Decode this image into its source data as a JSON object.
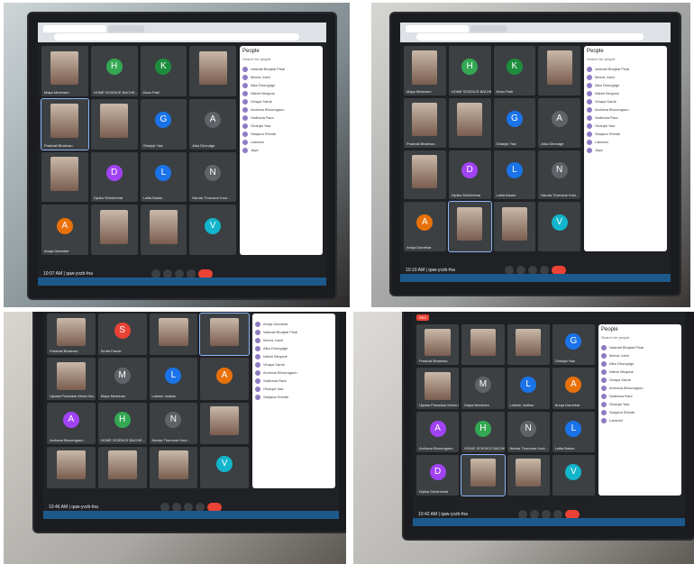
{
  "panels": [
    {
      "people_title": "People",
      "search": "Search for people",
      "clock": "10:07 AM",
      "meeting_code": "qaw-yvzb-fna",
      "tiles": [
        {
          "name": "Maya Meshram",
          "initial": "",
          "color": "",
          "cam": true
        },
        {
          "name": "HOME SCIENCE BACHE...",
          "initial": "H",
          "color": "#34a853",
          "cam": false
        },
        {
          "name": "Khan Patil",
          "initial": "K",
          "color": "#1e8e3e",
          "cam": false
        },
        {
          "name": "",
          "initial": "",
          "color": "",
          "cam": true
        },
        {
          "name": "Prashali Bhalerao",
          "initial": "",
          "color": "",
          "cam": true,
          "active": true
        },
        {
          "name": "",
          "initial": "",
          "color": "",
          "cam": true
        },
        {
          "name": "Ghanjal Yaw",
          "initial": "G",
          "color": "#1a73e8",
          "cam": false
        },
        {
          "name": "Alka Dhondge",
          "initial": "A",
          "color": "#5f6368",
          "cam": false
        },
        {
          "name": "",
          "initial": "",
          "color": "",
          "cam": true
        },
        {
          "name": "Dipika Shrishrimal",
          "initial": "D",
          "color": "#a142f4",
          "cam": false
        },
        {
          "name": "Lalita Baske",
          "initial": "L",
          "color": "#1a73e8",
          "cam": false
        },
        {
          "name": "Nanda Thorvane Koul...",
          "initial": "N",
          "color": "#5f6368",
          "cam": false
        },
        {
          "name": "Anuja Darvekar",
          "initial": "A",
          "color": "#e8710a",
          "cam": false
        },
        {
          "name": "",
          "initial": "",
          "color": "",
          "cam": true
        },
        {
          "name": "",
          "initial": "",
          "color": "",
          "cam": true
        },
        {
          "name": "",
          "initial": "V",
          "color": "#12b5cb",
          "cam": false
        }
      ],
      "people": [
        "Vaishali Bhujbal Pisal",
        "Meera Joshi",
        "Alka Dhongdge",
        "Nilesh Bhojane",
        "Vinaya Sarde",
        "Archana Bhoomgaon",
        "Sadhana Raut",
        "Ghanjal Yaw",
        "Sanjana Shinde",
        "Lakshmi",
        "Jaya"
      ]
    },
    {
      "people_title": "People",
      "search": "Search for people",
      "clock": "10:10 AM",
      "meeting_code": "qaw-yvzb-fna",
      "tiles": [
        {
          "name": "Maya Meshram",
          "initial": "",
          "color": "",
          "cam": true
        },
        {
          "name": "HOME SCIENCE BACHE...",
          "initial": "H",
          "color": "#34a853",
          "cam": false
        },
        {
          "name": "Khan Patil",
          "initial": "K",
          "color": "#1e8e3e",
          "cam": false
        },
        {
          "name": "",
          "initial": "",
          "color": "",
          "cam": true
        },
        {
          "name": "Prashali Bhalerao",
          "initial": "",
          "color": "",
          "cam": true
        },
        {
          "name": "",
          "initial": "",
          "color": "",
          "cam": true
        },
        {
          "name": "Ghanjal Yaw",
          "initial": "G",
          "color": "#1a73e8",
          "cam": false
        },
        {
          "name": "Alka Dhondge",
          "initial": "A",
          "color": "#5f6368",
          "cam": false
        },
        {
          "name": "",
          "initial": "",
          "color": "",
          "cam": true
        },
        {
          "name": "Dipika Shrishrimal",
          "initial": "D",
          "color": "#a142f4",
          "cam": false
        },
        {
          "name": "Lalita Baske",
          "initial": "L",
          "color": "#1a73e8",
          "cam": false
        },
        {
          "name": "Nanda Thorvane Koul...",
          "initial": "N",
          "color": "#5f6368",
          "cam": false
        },
        {
          "name": "Anuja Darvekar",
          "initial": "A",
          "color": "#e8710a",
          "cam": false
        },
        {
          "name": "",
          "initial": "",
          "color": "",
          "cam": true,
          "active": true
        },
        {
          "name": "",
          "initial": "",
          "color": "",
          "cam": true
        },
        {
          "name": "",
          "initial": "V",
          "color": "#12b5cb",
          "cam": false
        }
      ],
      "people": [
        "Vaishali Bhujbal Pisal",
        "Meera Joshi",
        "Alka Dhongdge",
        "Nilesh Bhojane",
        "Vinaya Sarde",
        "Archana Bhoomgaon",
        "Sadhana Raut",
        "Ghanjal Yaw",
        "Sanjana Shinde",
        "Lakshmi",
        "Jaya"
      ]
    },
    {
      "people_title": "",
      "search": "",
      "clock": "10:46 AM",
      "meeting_code": "qaw-yvzb-fna",
      "tiles": [
        {
          "name": "Prashali Bhalerao",
          "initial": "",
          "color": "",
          "cam": true
        },
        {
          "name": "Smita Pande",
          "initial": "S",
          "color": "#ea4335",
          "cam": false
        },
        {
          "name": "",
          "initial": "",
          "color": "",
          "cam": true
        },
        {
          "name": "",
          "initial": "",
          "color": "",
          "cam": true,
          "active": true
        },
        {
          "name": "Ujwala Pohankar Mosin Mo...",
          "initial": "",
          "color": "",
          "cam": true
        },
        {
          "name": "Maya Meshram",
          "initial": "M",
          "color": "#5f6368",
          "cam": false
        },
        {
          "name": "Lokesh Jadhav",
          "initial": "L",
          "color": "#1a73e8",
          "cam": false
        },
        {
          "name": "",
          "initial": "A",
          "color": "#e8710a",
          "cam": false
        },
        {
          "name": "Archana Bhoomgaon",
          "initial": "A",
          "color": "#a142f4",
          "cam": false
        },
        {
          "name": "HOME SCIENCE BACHE...",
          "initial": "H",
          "color": "#34a853",
          "cam": false
        },
        {
          "name": "Nanda Thorvane Koul...",
          "initial": "N",
          "color": "#5f6368",
          "cam": false
        },
        {
          "name": "",
          "initial": "",
          "color": "",
          "cam": true
        },
        {
          "name": "",
          "initial": "",
          "color": "",
          "cam": true
        },
        {
          "name": "",
          "initial": "",
          "color": "",
          "cam": true
        },
        {
          "name": "",
          "initial": "",
          "color": "",
          "cam": true
        },
        {
          "name": "",
          "initial": "V",
          "color": "#12b5cb",
          "cam": false
        }
      ],
      "people": [
        "Anuja Darvekar",
        "Vaishali Bhujbal Pisal",
        "Meera Joshi",
        "Alka Dhongdge",
        "Nilesh Bhojane",
        "Vinaya Sarde",
        "Archana Bhoomgaon",
        "Sadhana Raut",
        "Ghanjal Yaw",
        "Sanjana Shinde"
      ]
    },
    {
      "people_title": "People",
      "search": "Search for people",
      "clock": "10:42 AM",
      "meeting_code": "qaw-yvzb-fna",
      "rec": "REC",
      "tiles": [
        {
          "name": "Prashali Bhalerao",
          "initial": "",
          "color": "",
          "cam": true
        },
        {
          "name": "",
          "initial": "",
          "color": "",
          "cam": true
        },
        {
          "name": "",
          "initial": "",
          "color": "",
          "cam": true
        },
        {
          "name": "Ghanjal Yaw",
          "initial": "G",
          "color": "#1a73e8",
          "cam": false
        },
        {
          "name": "Ujwala Pohankar Mosin Mo...",
          "initial": "",
          "color": "",
          "cam": true
        },
        {
          "name": "Maya Meshram",
          "initial": "M",
          "color": "#5f6368",
          "cam": false
        },
        {
          "name": "Lokesh Jadhav",
          "initial": "L",
          "color": "#1a73e8",
          "cam": false
        },
        {
          "name": "Anuja Darvekar",
          "initial": "A",
          "color": "#e8710a",
          "cam": false
        },
        {
          "name": "Archana Bhoomgaon",
          "initial": "A",
          "color": "#a142f4",
          "cam": false
        },
        {
          "name": "HOME SCIENCE BACHE...",
          "initial": "H",
          "color": "#34a853",
          "cam": false
        },
        {
          "name": "Nanda Thorvane Koul...",
          "initial": "N",
          "color": "#5f6368",
          "cam": false
        },
        {
          "name": "Lalita Baske",
          "initial": "L",
          "color": "#1a73e8",
          "cam": false
        },
        {
          "name": "Dipika Shrishrimal",
          "initial": "D",
          "color": "#a142f4",
          "cam": false
        },
        {
          "name": "",
          "initial": "",
          "color": "",
          "cam": true,
          "active": true
        },
        {
          "name": "",
          "initial": "",
          "color": "",
          "cam": true
        },
        {
          "name": "",
          "initial": "V",
          "color": "#12b5cb",
          "cam": false
        }
      ],
      "people": [
        "Vaishali Bhujbal Pisal",
        "Meera Joshi",
        "Alka Dhongdge",
        "Nilesh Bhojane",
        "Vinaya Sarde",
        "Archana Bhoomgaon",
        "Sadhana Raut",
        "Ghanjal Yaw",
        "Sanjana Shinde",
        "Lakshmi"
      ]
    }
  ]
}
